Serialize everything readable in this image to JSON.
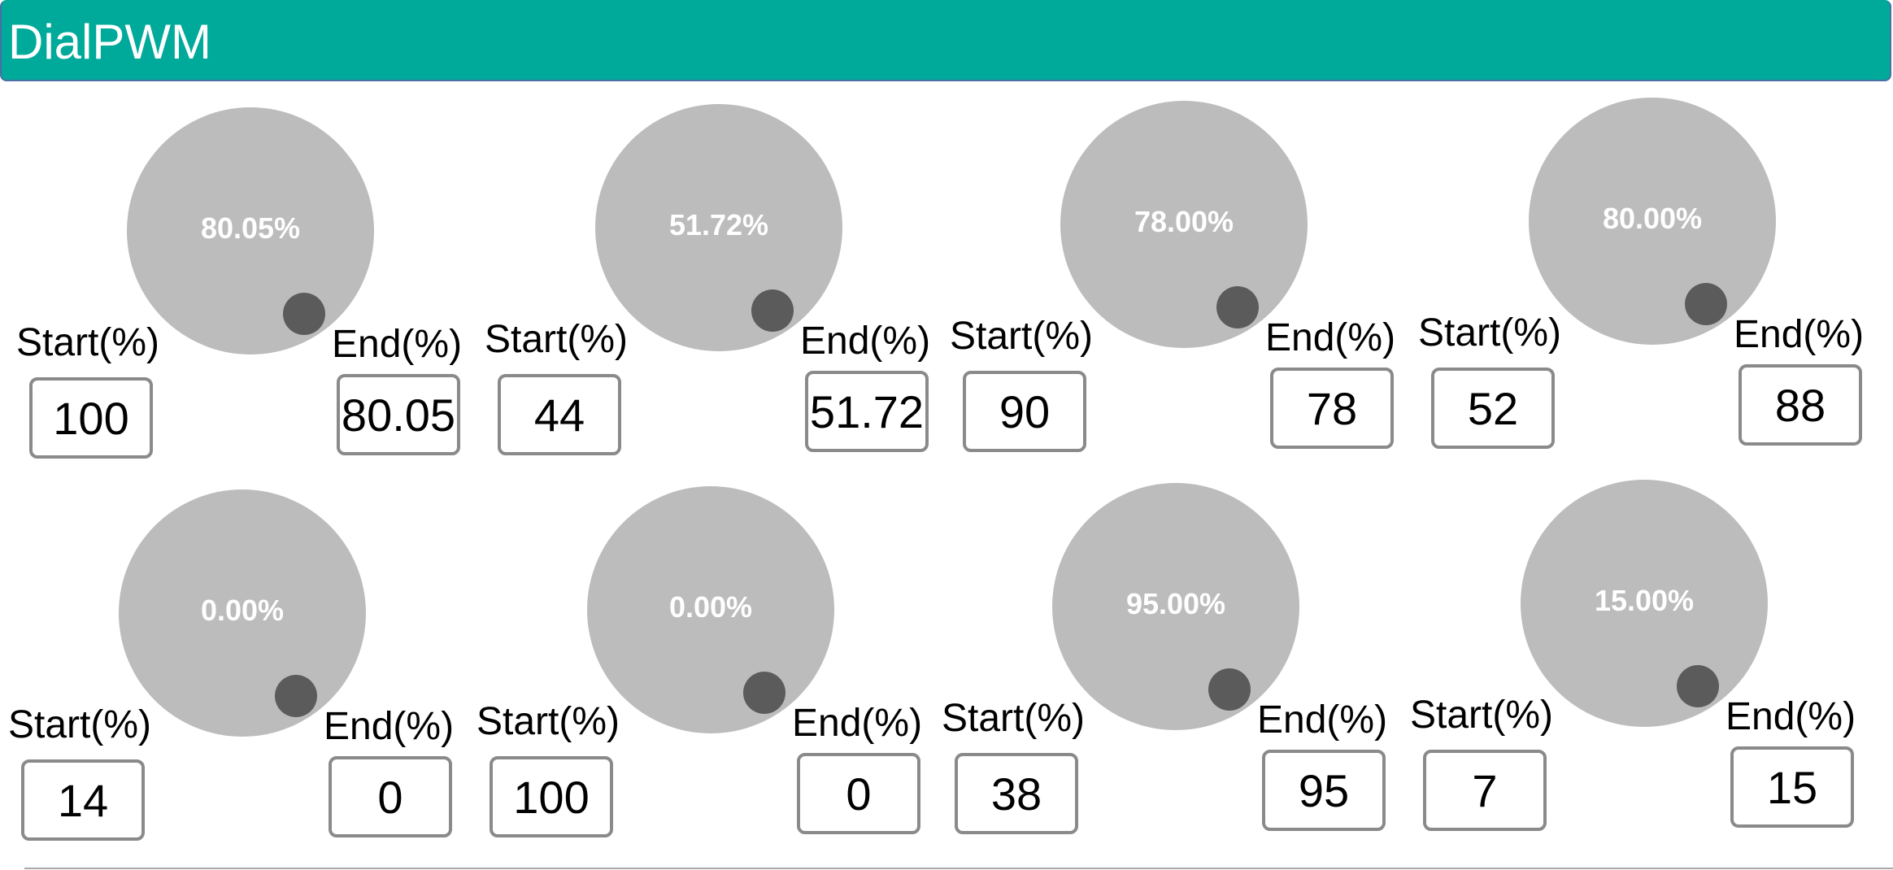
{
  "app": {
    "title": "DialPWM"
  },
  "labels": {
    "start": "Start(%)",
    "end": "End(%)"
  },
  "colors": {
    "header": "#00aa9a",
    "dial": "#bcbcbc",
    "knob": "#5b5b5b",
    "box_border": "#8a8a8a"
  },
  "dials": [
    {
      "value": "80.05%",
      "start": "100",
      "end": "80.05"
    },
    {
      "value": "51.72%",
      "start": "44",
      "end": "51.72"
    },
    {
      "value": "78.00%",
      "start": "90",
      "end": "78"
    },
    {
      "value": "80.00%",
      "start": "52",
      "end": "88"
    },
    {
      "value": "0.00%",
      "start": "14",
      "end": "0"
    },
    {
      "value": "0.00%",
      "start": "100",
      "end": "0"
    },
    {
      "value": "95.00%",
      "start": "38",
      "end": "95"
    },
    {
      "value": "15.00%",
      "start": "7",
      "end": "15"
    }
  ]
}
